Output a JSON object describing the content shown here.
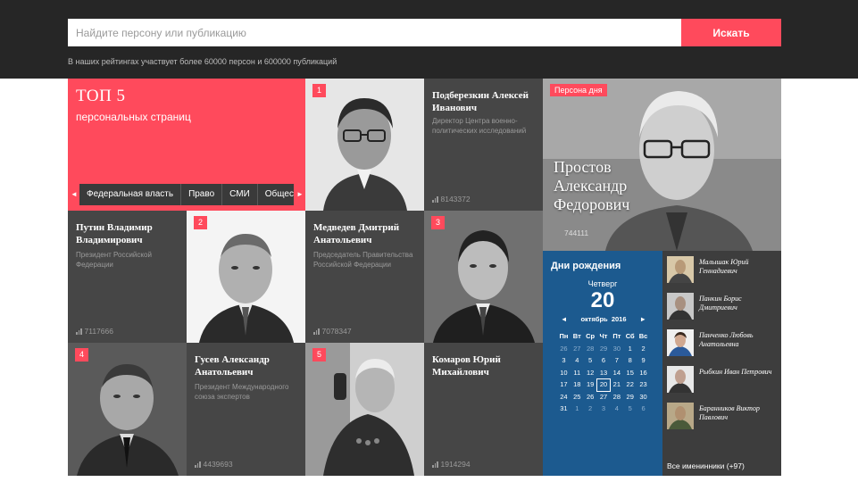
{
  "search": {
    "placeholder": "Найдите персону или публикацию",
    "button": "Искать"
  },
  "info": "В наших рейтингах участвует более 60000 персон и 600000 публикаций",
  "top5": {
    "title": "ТОП 5",
    "subtitle": "персональных страниц",
    "categories": [
      "Федеральная власть",
      "Право",
      "СМИ",
      "Общество"
    ]
  },
  "persons": [
    {
      "rank": "1"
    },
    {
      "name": "Подберезкин Алексей Иванович",
      "desc": "Директор Центра военно-политических исследований",
      "views": "8143372"
    },
    {
      "name": "Путин Владимир Владимирович",
      "desc": "Президент Российской Федерации",
      "views": "7117666"
    },
    {
      "rank": "2"
    },
    {
      "name": "Медведев Дмитрий Анатольевич",
      "desc": "Председатель Правительства Российской Федерации",
      "views": "7078347"
    },
    {
      "rank": "3"
    },
    {
      "rank": "4"
    },
    {
      "name": "Гусев Александр Анатольевич",
      "desc": "Президент Международного союза экспертов",
      "views": "4439693"
    },
    {
      "rank": "5"
    },
    {
      "name": "Комаров Юрий Михайлович",
      "desc": "",
      "views": "1914294"
    }
  ],
  "persona_day": {
    "badge": "Персона дня",
    "name": "Простов Александр Федорович",
    "views": "744111"
  },
  "birthdays": {
    "title": "Дни рождения",
    "weekday": "Четверг",
    "day": "20",
    "month": "октябрь",
    "year": "2016",
    "prev": "◄",
    "next": "►",
    "weekdays": [
      "Пн",
      "Вт",
      "Ср",
      "Чт",
      "Пт",
      "Сб",
      "Вс"
    ],
    "cells": [
      "26",
      "27",
      "28",
      "29",
      "30",
      "1",
      "2",
      "3",
      "4",
      "5",
      "6",
      "7",
      "8",
      "9",
      "10",
      "11",
      "12",
      "13",
      "14",
      "15",
      "16",
      "17",
      "18",
      "19",
      "20",
      "21",
      "22",
      "23",
      "24",
      "25",
      "26",
      "27",
      "28",
      "29",
      "30",
      "31",
      "1",
      "2",
      "3",
      "4",
      "5",
      "6"
    ],
    "people": [
      "Малышак Юрий Геннадиевич",
      "Панкин Борис Дмитриевич",
      "Панченко Любовь Анатольевна",
      "Рыбкин Иван Петрович",
      "Баранников Виктор Павлович"
    ],
    "all_link": "Все именинники (+97)"
  },
  "colors": {
    "accent": "#ff4a5c",
    "header": "#262626",
    "calendar": "#1c5a8f",
    "tile": "#464646"
  }
}
